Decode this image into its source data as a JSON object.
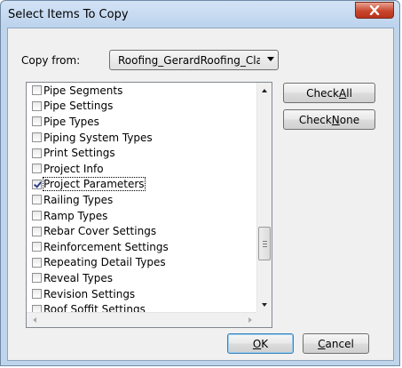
{
  "window": {
    "title": "Select Items To Copy"
  },
  "copy_from": {
    "label": "Copy from:",
    "value": "Roofing_GerardRoofing_Class"
  },
  "list": {
    "items": [
      {
        "label": "Pipe Segments",
        "checked": false
      },
      {
        "label": "Pipe Settings",
        "checked": false
      },
      {
        "label": "Pipe Types",
        "checked": false
      },
      {
        "label": "Piping System Types",
        "checked": false
      },
      {
        "label": "Print Settings",
        "checked": false
      },
      {
        "label": "Project Info",
        "checked": false
      },
      {
        "label": "Project Parameters",
        "checked": true,
        "focused": true
      },
      {
        "label": "Railing Types",
        "checked": false
      },
      {
        "label": "Ramp Types",
        "checked": false
      },
      {
        "label": "Rebar Cover Settings",
        "checked": false
      },
      {
        "label": "Reinforcement Settings",
        "checked": false
      },
      {
        "label": "Repeating Detail Types",
        "checked": false
      },
      {
        "label": "Reveal Types",
        "checked": false
      },
      {
        "label": "Revision Settings",
        "checked": false
      },
      {
        "label": "Roof Soffit Settings",
        "checked": false
      }
    ],
    "scroll_position": 0.78
  },
  "buttons": {
    "check_all": {
      "pre": "Check ",
      "accel": "A",
      "post": "ll"
    },
    "check_none": {
      "pre": "Check ",
      "accel": "N",
      "post": "one"
    },
    "ok": {
      "pre": "",
      "accel": "O",
      "post": "K"
    },
    "cancel": {
      "pre": "",
      "accel": "C",
      "post": "ancel"
    }
  },
  "icons": {
    "close": "close-icon",
    "dropdown": "chevron-down-icon"
  },
  "colors": {
    "frame": "#bfd5ec",
    "client": "#f0f0f0",
    "close": "#c9472e",
    "check": "#2b3f8c"
  }
}
